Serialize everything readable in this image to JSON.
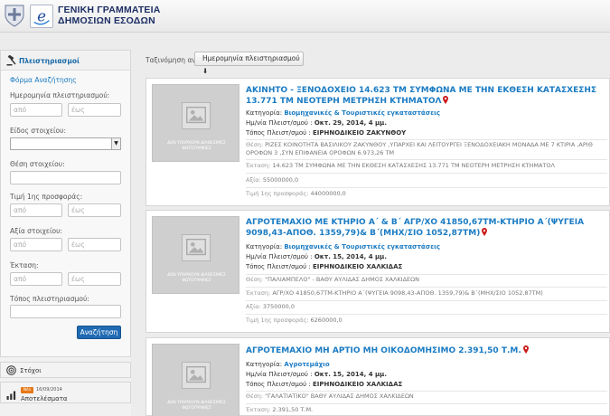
{
  "header": {
    "org_line1": "ΓΕΝΙΚΗ ΓΡΑΜΜΑΤΕΙΑ",
    "org_line2": "ΔΗΜΟΣΙΩΝ ΕΣΟΔΩΝ"
  },
  "sidebar": {
    "panel_title": "Πλειστηριασμοί",
    "form_title": "Φόρμα Αναζήτησης",
    "fields": {
      "auction_date_label": "Ημερομηνία πλειστηριασμού:",
      "item_type_label": "Είδος στοιχείου:",
      "item_location_label": "Θέση στοιχείου:",
      "first_offer_price_label": "Τιμή 1ης προσφοράς:",
      "item_value_label": "Αξία στοιχείου:",
      "area_label": "Έκταση:",
      "auction_place_label": "Τόπος πλειστηριασμού:",
      "from_placeholder": "από",
      "to_placeholder": "έως"
    },
    "search_button": "Αναζήτηση",
    "targets_label": "Στόχοι",
    "news": {
      "badge": "Νέο",
      "date": "16/09/2014",
      "label": "Αποτελέσματα"
    }
  },
  "sort": {
    "label": "Ταξινόμηση ανά:",
    "value": "Ημερομηνία πλειστηριασμού ⬇"
  },
  "labels": {
    "category": "Κατηγορία:",
    "date": "Ημ/νία Πλειστ/σμού :",
    "place": "Τόπος Πλειστ/σμού :",
    "position": "Θέση:",
    "area": "Έκταση:",
    "value": "Αξία:",
    "first_offer": "Τιμή 1ης προσφοράς:",
    "no_photos": "ΔΕΝ ΥΠΑΡΧΟΥΝ ΔΙΑΘΕΣΙΜΕΣ ΦΩΤΟΓΡΑΦΙΕΣ"
  },
  "results": [
    {
      "title": "ΑΚΙΝΗΤΟ - ΞΕΝΟΔΟΧΕΙΟ 14.623 ΤΜ ΣΥΜΦΩΝΑ ΜΕ ΤΗΝ ΕΚΘΕΣΗ ΚΑΤΑΣΧΕΣΗΣ 13.771 ΤΜ ΝΕΟΤΕΡΗ ΜΕΤΡΗΣΗ ΚΤΗΜΑΤΟΛ",
      "category": "Βιομηχανικές & Τουριστικές εγκαταστάσεις",
      "date": "Οκτ. 29, 2014, 4 μμ.",
      "place": "ΕΙΡΗΝΟΔΙΚΕΙΟ ΖΑΚΥΝΘΟΥ",
      "position": "ΡΙΖΕΣ ΚΟΙΝΟΤΗΤΑ ΒΑΣΙΛΙΚΟΥ ΖΑΚΥΝΘΟΥ ,ΥΠΑΡΧΕΙ ΚΑΙ ΛΕΙΤΟΥΡΓΕΙ ΞΕΝΟΔΟΧΕΙΑΚΗ ΜΟΝΑΔΑ ΜΕ 7 ΚΤΙΡΙΑ ,ΑΡΙΘ ΟΡΟΦΩΝ 3 ,ΣΥΝ ΕΠΙΦΑΝΕΙΑ ΟΡΟΦΩΝ 6.973,26 ΤΜ",
      "area": "14.623 ΤΜ ΣΥΜΦΩΝΑ ΜΕ ΤΗΝ ΕΚΘΕΣΗ ΚΑΤΑΣΧΕΣΗΣ 13.771 ΤΜ ΝΕΟΤΕΡΗ ΜΕΤΡΗΣΗ ΚΤΗΜΑΤΟΛ",
      "value": "55000000,0",
      "first_offer": "44000000,0"
    },
    {
      "title": "ΑΓΡΟΤΕΜΑΧΙΟ ΜΕ ΚΤΗΡΙΟ Α΄ & Β΄ ΑΓΡ/ΧΟ 41850,67ΤΜ-ΚΤΗΡΙΟ Α΄(ΨΥΓΕΙΑ 9098,43-ΑΠΟΘ. 1359,79)& Β΄(ΜΗΧ/ΣΙΟ 1052,87ΤΜ)",
      "category": "Βιομηχανικές & Τουριστικές εγκαταστάσεις",
      "date": "Οκτ. 15, 2014, 4 μμ.",
      "place": "ΕΙΡΗΝΟΔΙΚΕΙΟ ΧΑΛΚΙΔΑΣ",
      "position": "\"ΠΑΛΙΑΜΠΕΛΟ\" - ΒΑΘΥ ΑΥΛΙΔΑΣ ΔΗΜΟΣ ΧΑΛΚΙΔΕΩΝ",
      "area": "ΑΓΡ/ΧΟ 41850,67ΤΜ-ΚΤΗΡΙΟ Α΄(ΨΥΓΕΙΑ 9098,43-ΑΠΟΘ. 1359,79)& Β΄(ΜΗΧ/ΣΙΟ 1052,87ΤΜ)",
      "value": "3750000,0",
      "first_offer": "6260000,0"
    },
    {
      "title": "ΑΓΡΟΤΕΜΑΧΙΟ ΜΗ ΑΡΤΙΟ ΜΗ ΟΙΚΟΔΟΜΗΣΙΜΟ 2.391,50 Τ.Μ.",
      "category": "Αγροτεμάχιο",
      "date": "Οκτ. 15, 2014, 4 μμ.",
      "place": "ΕΙΡΗΝΟΔΙΚΕΙΟ ΧΑΛΚΙΔΑΣ",
      "position": "\"ΓΑΛΑΤΙΑΤΙΚΟ\" ΒΑΘΥ ΑΥΛΙΔΑΣ ΔΗΜΟΣ ΧΑΛΚΙΔΕΩΝ",
      "area": "2.391,50 Τ.Μ."
    }
  ],
  "colors": {
    "link_blue": "#1a7bc3",
    "button_blue": "#1f6ab3",
    "pin_red": "#cc1f1f",
    "badge_orange": "#e67817"
  }
}
